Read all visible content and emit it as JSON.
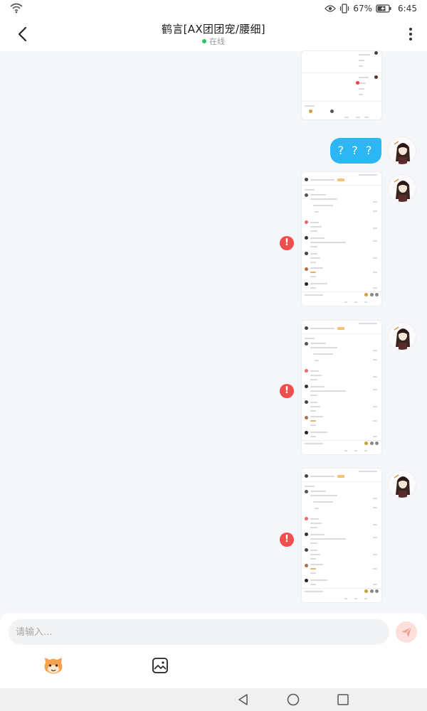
{
  "status_bar": {
    "battery_pct": "67%",
    "time": "6:45"
  },
  "header": {
    "title": "鹤言[AX团团宠/腰细]",
    "status": "在线",
    "status_color": "#29c15b"
  },
  "chat": {
    "text_message": "? ? ?",
    "bubble_color": "#2eb6f2",
    "error_icon": "!",
    "error_color": "#f24e4e"
  },
  "composer": {
    "placeholder": "请输入...",
    "send_icon": "send-icon",
    "emoji_icon": "emoji-face-icon",
    "image_icon": "image-icon"
  },
  "nav": {
    "back": "nav-back-icon",
    "home": "nav-home-icon",
    "recent": "nav-recent-icon"
  }
}
